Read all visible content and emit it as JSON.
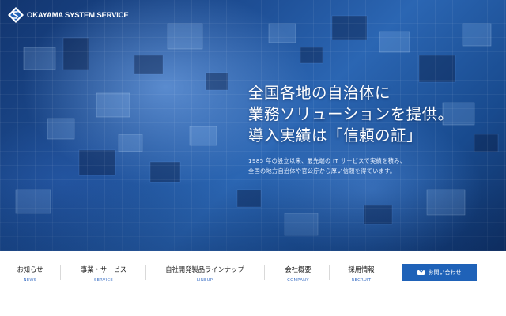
{
  "brand": {
    "name": "OKAYAMA SYSTEM SERVICE"
  },
  "hero": {
    "headline": [
      "全国各地の自治体に",
      "業務ソリューションを提供。",
      "導入実績は「信頼の証」"
    ],
    "lead": [
      "1985 年の設立以来、最先端の IT サービスで実績を積み、",
      "全国の地方自治体や官公庁から厚い信頼を得ています。"
    ]
  },
  "nav": {
    "items": [
      {
        "label": "お知らせ",
        "sub": "NEWS"
      },
      {
        "label": "事業・サービス",
        "sub": "SERVICE"
      },
      {
        "label": "自社開発製品ラインナップ",
        "sub": "LINEUP"
      },
      {
        "label": "会社概要",
        "sub": "COMPANY"
      },
      {
        "label": "採用情報",
        "sub": "RECRUIT"
      }
    ],
    "contact_label": "お問い合わせ"
  },
  "colors": {
    "accent": "#1f62b8",
    "nav_sub": "#3a6fc4"
  },
  "icons": {
    "logo": "diamond-logo-icon",
    "contact": "mail-icon"
  }
}
